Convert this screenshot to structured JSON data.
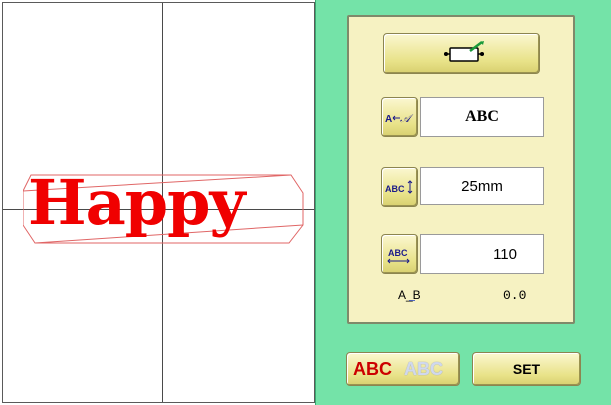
{
  "preview": {
    "embroidery_text": "Happy",
    "text_color": "#f00000",
    "frame_color": "#e06666",
    "axis_color": "#4a4a4a"
  },
  "panel": {
    "background_color": "#74e3a8",
    "card_color": "#f6f2c2",
    "frame_button_icon": "hoop-frame-icon",
    "text_button_icon": "text-input-icon",
    "height_button_icon": "text-height-icon",
    "width_button_icon": "text-width-icon",
    "text_value": "ABC",
    "height_value": "25mm",
    "width_value": "110",
    "spacing_label": "A_B",
    "spacing_value": "0.0",
    "font_label_primary": "ABC",
    "font_label_secondary": "ABC",
    "set_label": "SET"
  }
}
